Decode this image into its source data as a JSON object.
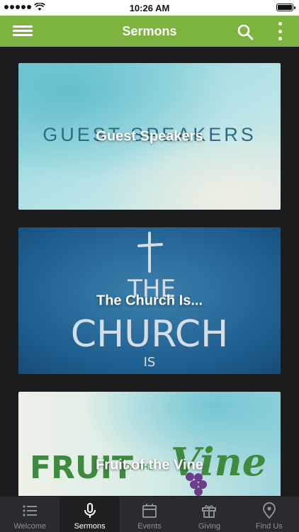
{
  "status_bar": {
    "time": "10:26 AM",
    "battery_level": 1.0
  },
  "app_bar": {
    "title": "Sermons"
  },
  "sermons": [
    {
      "title": "Guest Speakers",
      "art_text": "GUEST SPEAKERS"
    },
    {
      "title": "The Church Is...",
      "art_text_lines": [
        "THE",
        "CHURCH",
        "IS"
      ]
    },
    {
      "title": "Fruit of the Vine",
      "art_text_left": "FRUIT",
      "art_text_mid": "OF THE",
      "art_text_right": "Vine"
    }
  ],
  "tabs": [
    {
      "label": "Welcome",
      "icon": "list-icon",
      "active": false
    },
    {
      "label": "Sermons",
      "icon": "microphone-icon",
      "active": true
    },
    {
      "label": "Events",
      "icon": "calendar-icon",
      "active": false
    },
    {
      "label": "Giving",
      "icon": "gift-icon",
      "active": false
    },
    {
      "label": "Find Us",
      "icon": "map-pin-icon",
      "active": false
    }
  ],
  "colors": {
    "accent": "#7db43f",
    "tabbar_bg": "#2a2b2e",
    "page_bg": "#1b1c1e"
  }
}
